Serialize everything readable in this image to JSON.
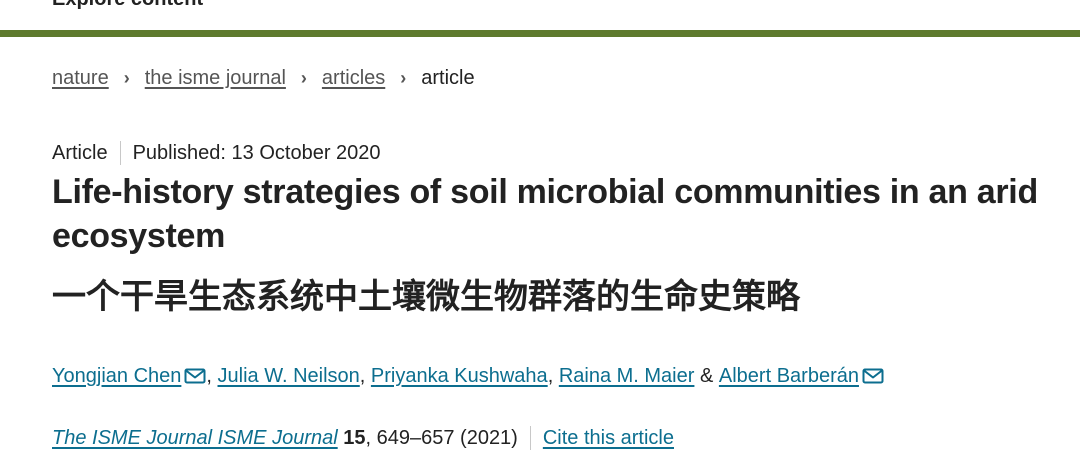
{
  "top_bar": {
    "label": "Explore content"
  },
  "colors": {
    "accent_rule": "#5e7a2e",
    "link": "#0c6e8f",
    "text": "#222222"
  },
  "breadcrumb": {
    "items": [
      {
        "label": "nature"
      },
      {
        "label": "the isme journal"
      },
      {
        "label": "articles"
      }
    ],
    "separator": "›",
    "current": "article"
  },
  "meta": {
    "type": "Article",
    "published": "Published: 13 October 2020"
  },
  "title": {
    "english": "Life-history strategies of soil microbial communities in an arid ecosystem",
    "chinese": "一个干旱生态系统中土壤微生物群落的生命史策略"
  },
  "authors": {
    "list": [
      {
        "name": "Yongjian Chen",
        "has_email": true
      },
      {
        "name": "Julia W. Neilson",
        "has_email": false
      },
      {
        "name": "Priyanka Kushwaha",
        "has_email": false
      },
      {
        "name": "Raina M. Maier",
        "has_email": false
      },
      {
        "name": "Albert Barberán",
        "has_email": true
      }
    ],
    "comma": ",",
    "ampersand": "&",
    "email_icon": "envelope-icon"
  },
  "citation": {
    "journal": "The ISME Journal  ISME Journal",
    "volume": "15",
    "pages_year": ", 649–657 (2021)",
    "cite_label": "Cite this article"
  }
}
